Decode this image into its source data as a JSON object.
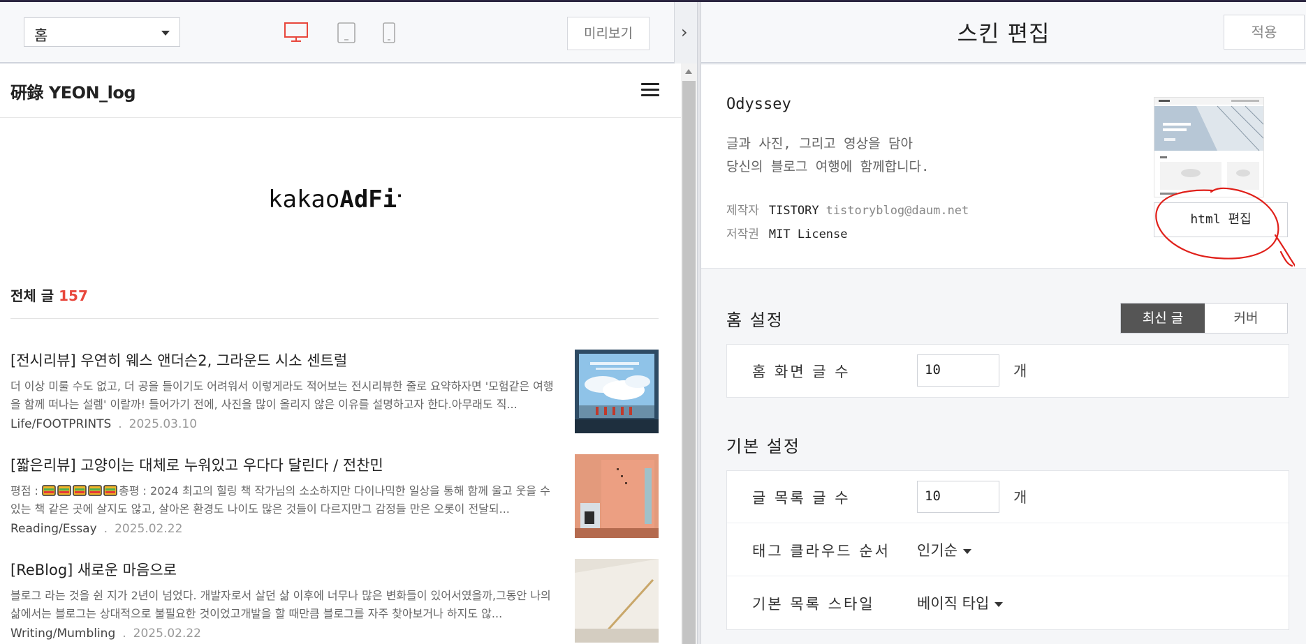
{
  "toolbar": {
    "page_select_value": "홈",
    "preview_label": "미리보기"
  },
  "blog": {
    "title": "硏錄 YEON_log",
    "ad_text_light": "kakao",
    "ad_text_bold": "AdFit",
    "total_label": "전체 글",
    "total_count": "157",
    "posts": [
      {
        "title": "[전시리뷰] 우연히 웨스 앤더슨2, 그라운드 시소 센트럴",
        "excerpt": "더 이상 미룰 수도 없고, 더 공을 들이기도 어려워서 이렇게라도 적어보는 전시리뷰한 줄로 요약하자면 '모험같은 여행을 함께 떠나는 설렘' 이랄까! 들어가기 전에, 사진을 많이 올리지 않은 이유를 설명하고자 한다.아무래도 직...",
        "category": "Life/FOOTPRINTS",
        "date": "2025.03.10"
      },
      {
        "title": "[짧은리뷰] 고양이는 대체로 누워있고 우다다 달린다 / 전찬민",
        "excerpt_prefix": "평점 : ",
        "rating_count": 5,
        "excerpt_rest": "총평 : 2024 최고의 힐링 책  작가님의 소소하지만 다이나믹한 일상을 통해 함께 울고 웃을 수 있는 책 같은 곳에 살지도 않고, 살아온 환경도 나이도 많은 것들이 다르지만그 감정들 만은 오롯이 전달되...",
        "category": "Reading/Essay",
        "date": "2025.02.22"
      },
      {
        "title": "[ReBlog] 새로운 마음으로",
        "excerpt": "블로그 라는 것을 쉰 지가 2년이 넘었다. 개발자로서 살던 삶 이후에 너무나 많은 변화들이 있어서였을까,그동안 나의 삶에서는 블로그는 상대적으로 불필요한 것이었고개발을 할 때만큼 블로그를 자주 찾아보거나 하지도 않...",
        "category": "Writing/Mumbling",
        "date": "2025.02.22"
      }
    ],
    "meta_separator": "."
  },
  "editor": {
    "title": "스킨 편집",
    "apply_label": "적용",
    "skin": {
      "name": "Odyssey",
      "desc_line1": "글과 사진, 그리고 영상을 담아",
      "desc_line2": "당신의 블로그 여행에 함께합니다.",
      "author_key": "제작자",
      "author_name": "TISTORY",
      "author_email": "tistoryblog@daum.net",
      "license_key": "저작권",
      "license_value": "MIT License",
      "html_edit_label": "html 편집"
    },
    "home_settings": {
      "title": "홈 설정",
      "tab_latest": "최신 글",
      "tab_cover": "커버",
      "post_count_label": "홈 화면 글 수",
      "post_count_value": "10",
      "unit": "개"
    },
    "basic_settings": {
      "title": "기본 설정",
      "list_count_label": "글 목록 글 수",
      "list_count_value": "10",
      "unit": "개",
      "tag_order_label": "태그 클라우드 순서",
      "tag_order_value": "인기순",
      "list_style_label": "기본 목록 스타일",
      "list_style_value": "베이직 타입"
    }
  },
  "colors": {
    "accent_red": "#e8473c",
    "annotation_red": "#e0201a",
    "active_tab": "#555555"
  },
  "icons": {
    "desktop": "desktop-icon",
    "tablet": "tablet-icon",
    "mobile": "mobile-icon",
    "menu": "hamburger-icon",
    "collapse": "chevron-right-icon"
  }
}
